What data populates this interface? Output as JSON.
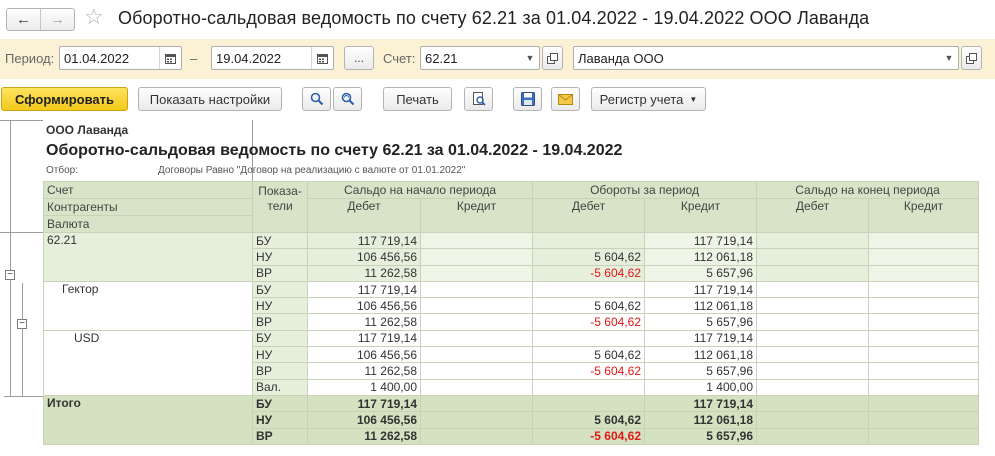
{
  "window": {
    "title": "Оборотно-сальдовая ведомость по счету 62.21 за 01.04.2022 - 19.04.2022 ООО Лаванда",
    "back_glyph": "←",
    "forward_glyph": "→",
    "favorite_glyph": "☆"
  },
  "params": {
    "period_label": "Период:",
    "date_from": "01.04.2022",
    "dash": "–",
    "date_to": "19.04.2022",
    "choose_period_label": "...",
    "account_label": "Счет:",
    "account_value": "62.21",
    "organization_value": "Лаванда ООО"
  },
  "toolbar": {
    "generate_label": "Сформировать",
    "settings_label": "Показать настройки",
    "print_label": "Печать",
    "register_label": "Регистр учета"
  },
  "report": {
    "org_name": "ООО Лаванда",
    "title": "Оборотно-сальдовая ведомость по счету 62.21 за 01.04.2022 - 19.04.2022",
    "filter_label": "Отбор:",
    "filter_value": "Договоры Равно \"Договор на реализацию с валюте от 01.01.2022\"",
    "headers": {
      "account": "Счет",
      "contractors": "Контрагенты",
      "currency": "Валюта",
      "indicators": "Показа-\nтели",
      "opening": "Сальдо на начало периода",
      "turnover": "Обороты за период",
      "closing": "Сальдо на конец периода",
      "debit": "Дебет",
      "credit": "Кредит"
    },
    "groups": [
      {
        "name": "62.21",
        "rows": [
          {
            "ind": "БУ",
            "od": "117 719,14",
            "oc": "",
            "td": "",
            "tc": "117 719,14",
            "cd": "",
            "cc": ""
          },
          {
            "ind": "НУ",
            "od": "106 456,56",
            "oc": "",
            "td": "5 604,62",
            "tc": "112 061,18",
            "cd": "",
            "cc": ""
          },
          {
            "ind": "ВР",
            "od": "11 262,58",
            "oc": "",
            "td": "-5 604,62",
            "tc": "5 657,96",
            "cd": "",
            "cc": ""
          }
        ]
      },
      {
        "name": "Гектор",
        "rows": [
          {
            "ind": "БУ",
            "od": "117 719,14",
            "oc": "",
            "td": "",
            "tc": "117 719,14",
            "cd": "",
            "cc": ""
          },
          {
            "ind": "НУ",
            "od": "106 456,56",
            "oc": "",
            "td": "5 604,62",
            "tc": "112 061,18",
            "cd": "",
            "cc": ""
          },
          {
            "ind": "ВР",
            "od": "11 262,58",
            "oc": "",
            "td": "-5 604,62",
            "tc": "5 657,96",
            "cd": "",
            "cc": ""
          }
        ]
      },
      {
        "name": "USD",
        "rows": [
          {
            "ind": "БУ",
            "od": "117 719,14",
            "oc": "",
            "td": "",
            "tc": "117 719,14",
            "cd": "",
            "cc": ""
          },
          {
            "ind": "НУ",
            "od": "106 456,56",
            "oc": "",
            "td": "5 604,62",
            "tc": "112 061,18",
            "cd": "",
            "cc": ""
          },
          {
            "ind": "ВР",
            "od": "11 262,58",
            "oc": "",
            "td": "-5 604,62",
            "tc": "5 657,96",
            "cd": "",
            "cc": ""
          },
          {
            "ind": "Вал.",
            "od": "1 400,00",
            "oc": "",
            "td": "",
            "tc": "1 400,00",
            "cd": "",
            "cc": ""
          }
        ]
      }
    ],
    "total": {
      "name": "Итого",
      "rows": [
        {
          "ind": "БУ",
          "od": "117 719,14",
          "oc": "",
          "td": "",
          "tc": "117 719,14",
          "cd": "",
          "cc": ""
        },
        {
          "ind": "НУ",
          "od": "106 456,56",
          "oc": "",
          "td": "5 604,62",
          "tc": "112 061,18",
          "cd": "",
          "cc": ""
        },
        {
          "ind": "ВР",
          "od": "11 262,58",
          "oc": "",
          "td": "-5 604,62",
          "tc": "5 657,96",
          "cd": "",
          "cc": ""
        }
      ]
    }
  },
  "colors": {
    "params_bg": "#fbf2d5",
    "header_bg": "#d8e4c8",
    "total_bg": "#d4e2c1",
    "negative": "#e01818",
    "primary_button": "#f3c91a"
  }
}
